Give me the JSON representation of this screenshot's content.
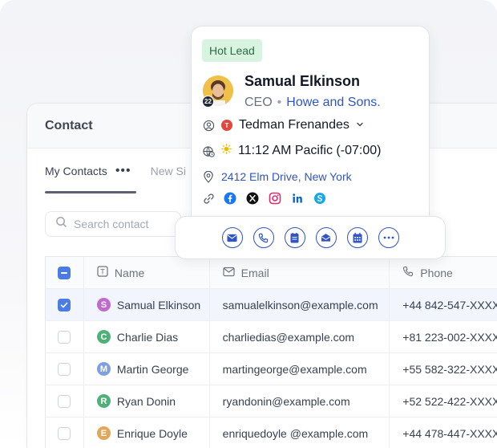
{
  "panel": {
    "title": "Contact",
    "tabs": [
      {
        "label": "My Contacts",
        "menu": "•••"
      },
      {
        "label": "New Si"
      }
    ]
  },
  "search": {
    "placeholder": "Search contact"
  },
  "table": {
    "columns": {
      "name": "Name",
      "email": "Email",
      "phone": "Phone"
    },
    "rows": [
      {
        "initial": "S",
        "color": "#c06ad0",
        "name": "Samual Elkinson",
        "email": "samualelkinson@example.com",
        "phone": "+44 842-547-XXXX",
        "checked": true
      },
      {
        "initial": "C",
        "color": "#4fb07a",
        "name": "Charlie Dias",
        "email": "charliedias@example.com",
        "phone": "+81 223-002-XXXX",
        "checked": false
      },
      {
        "initial": "M",
        "color": "#7e9fe0",
        "name": "Martin George",
        "email": "martingeorge@example.com",
        "phone": "+55 582-322-XXXX",
        "checked": false
      },
      {
        "initial": "R",
        "color": "#4fb07a",
        "name": "Ryan Donin",
        "email": "ryandonin@example.com",
        "phone": "+52 522-422-XXXX",
        "checked": false
      },
      {
        "initial": "E",
        "color": "#e0a85a",
        "name": "Enrique Doyle",
        "email": "enriquedoyle @example.com",
        "phone": "+44 478-447-XXXX",
        "checked": false
      }
    ]
  },
  "profile": {
    "badge": "Hot Lead",
    "avatar_count": "22",
    "name": "Samual Elkinson",
    "role": "CEO",
    "separator": "•",
    "company": "Howe and Sons.",
    "owner_initial": "T",
    "owner": "Tedman Frenandes",
    "time": "11:12 AM Pacific (-07:00)",
    "address": "2412 Elm Drive, New York",
    "socials": [
      "facebook-icon",
      "x-icon",
      "instagram-icon",
      "linkedin-icon",
      "skype-icon"
    ]
  },
  "actions": [
    "email-icon",
    "phone-icon",
    "note-icon",
    "mail-open-icon",
    "calendar-icon",
    "more-icon"
  ],
  "colors": {
    "accent": "#2f55c6",
    "checkbox": "#4b7be5",
    "hot_lead_bg": "#d9f3e1"
  }
}
